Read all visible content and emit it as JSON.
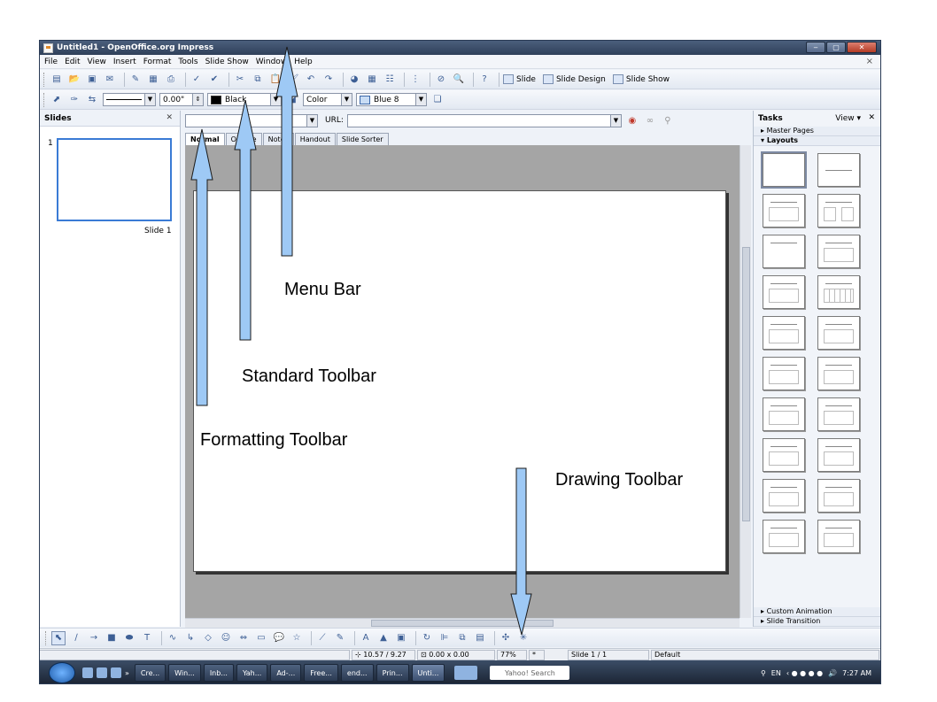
{
  "window": {
    "title": "Untitled1 - OpenOffice.org Impress",
    "close_glyph": "×"
  },
  "menu": [
    "File",
    "Edit",
    "View",
    "Insert",
    "Format",
    "Tools",
    "Slide Show",
    "Window",
    "Help"
  ],
  "standard_toolbar": {
    "slide_label": "Slide",
    "slide_design_label": "Slide Design",
    "slide_show_label": "Slide Show"
  },
  "formatting_toolbar": {
    "line_width": "0.00\"",
    "line_color": "Black",
    "area_style": "Color",
    "area_color": "Blue 8"
  },
  "hyperlink_bar": {
    "url_label": "URL:"
  },
  "slides_pane": {
    "title": "Slides",
    "slide_number": "1",
    "slide_name": "Slide 1"
  },
  "view_tabs": [
    "Normal",
    "Outline",
    "Notes",
    "Handout",
    "Slide Sorter"
  ],
  "tasks_pane": {
    "title": "Tasks",
    "view_label": "View",
    "sections_top": [
      "Master Pages",
      "Layouts"
    ],
    "sections_bottom": [
      "Custom Animation",
      "Slide Transition"
    ]
  },
  "status_bar": {
    "position": "10.57 / 9.27",
    "size": "0.00 x 0.00",
    "zoom": "77%",
    "modified": "*",
    "slide": "Slide 1 / 1",
    "master": "Default"
  },
  "taskbar": {
    "buttons": [
      "Cre...",
      "Win...",
      "Inb...",
      "Yah...",
      "Ad-...",
      "Free...",
      "end...",
      "Prin...",
      "Unti..."
    ],
    "search": "Yahoo! Search",
    "language": "EN",
    "time": "7:27 AM"
  },
  "annotations": {
    "menu_bar": "Menu Bar",
    "standard_toolbar": "Standard Toolbar",
    "formatting_toolbar": "Formatting Toolbar",
    "drawing_toolbar": "Drawing Toolbar"
  },
  "colors": {
    "arrow_fill": "#9ec9f5",
    "arrow_stroke": "#1a1a1a",
    "titlebar": "#2f405a",
    "workspace": "#a5a5a5",
    "slide_selection": "#3a7bd5"
  }
}
